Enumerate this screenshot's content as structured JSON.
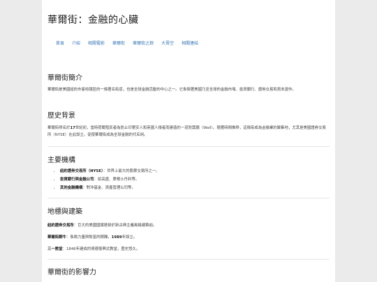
{
  "site_title": "華爾街：金融的心臟",
  "nav": [
    "首頁",
    "介紹",
    "相關電影",
    "華爾街",
    "華爾街之狼",
    "大賣空",
    "相關連結"
  ],
  "intro": {
    "heading": "華爾街簡介",
    "text": "華爾街是美國紐約市曼哈頓區的一條著名街道，也是全球金融活動的中心之一。它象徵著美國乃至全球的金融市場、投資銀行、證券交易和資本運作。"
  },
  "history": {
    "heading": "歷史背景",
    "text_before": "華爾街得名於",
    "century": "17",
    "text_after": "世紀初，當時荷蘭殖民者為防止印第安人和英國人侵者而建造的一道防禦牆（Wall）。隨著時間推移，這條街成為金融業的聚集地，尤其是美國證券交易所（NYSE）在此設立，促使華爾街成為全球金融的代名詞。"
  },
  "institutions": {
    "heading": "主要機構",
    "items": [
      {
        "name": "紐約證券交易所（NYSE）",
        "desc": "：世界上最大的股票交易所之一。"
      },
      {
        "name": "投資銀行與金融公司",
        "desc": "：如高盛、摩根士丹利等。"
      },
      {
        "name": "其他金融機構",
        "desc": "：對沖基金、資產管理公司等。"
      }
    ]
  },
  "landmarks": {
    "heading": "地標與建築",
    "items": [
      {
        "name": "紐約證券交易所",
        "desc": "：巨大的美國國旗懸掛於新古典主義風格建築前。"
      },
      {
        "name": "華爾街銅牛",
        "desc": "：象徵力量與財富的銅雕，",
        "year": "1989",
        "tail": "年設立。"
      },
      {
        "name": "三一教堂",
        "desc": "：",
        "year": "1846",
        "tail": "年建成的哥德復興式教堂，歷史悠久。"
      }
    ]
  },
  "impact": {
    "heading": "華爾街的影響力"
  }
}
